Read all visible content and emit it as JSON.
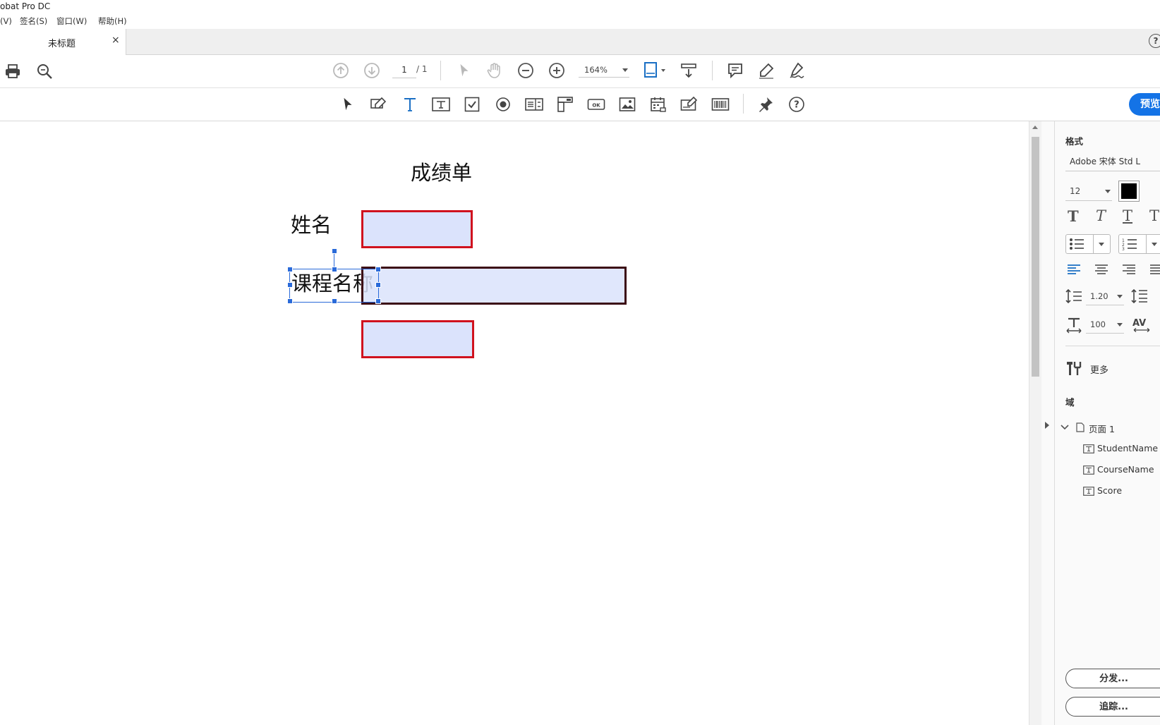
{
  "window": {
    "title": "obat Pro DC"
  },
  "menu": {
    "items": [
      "(V)",
      "签名(S)",
      "窗口(W)",
      "帮助(H)"
    ]
  },
  "tabs": {
    "doc_tab_label": "未标题",
    "close_glyph": "×",
    "help_glyph": "?"
  },
  "toolbar": {
    "page_current": "1",
    "page_total": "/ 1",
    "zoom": "164%"
  },
  "form_toolbar": {
    "help_glyph": "?",
    "preview_label": "预览"
  },
  "document": {
    "title": "成绩单",
    "label_name": "姓名",
    "label_course": "课程名称"
  },
  "panel": {
    "format_heading": "格式",
    "font_name": "Adobe 宋体 Std L",
    "font_size": "12",
    "text_color": "#000000",
    "line_spacing": "1.20",
    "scale": "100",
    "more_label": "更多",
    "fields_heading": "域",
    "page_node": "页面 1",
    "fields": [
      "StudentName",
      "CourseName",
      "Score"
    ],
    "distribute_button": "分发...",
    "track_button": "追踪..."
  },
  "colors": {
    "accent": "#1473e6",
    "field_fill": "#dbe3fc",
    "field_border": "#d0121e",
    "selection": "#2a6ad9"
  }
}
